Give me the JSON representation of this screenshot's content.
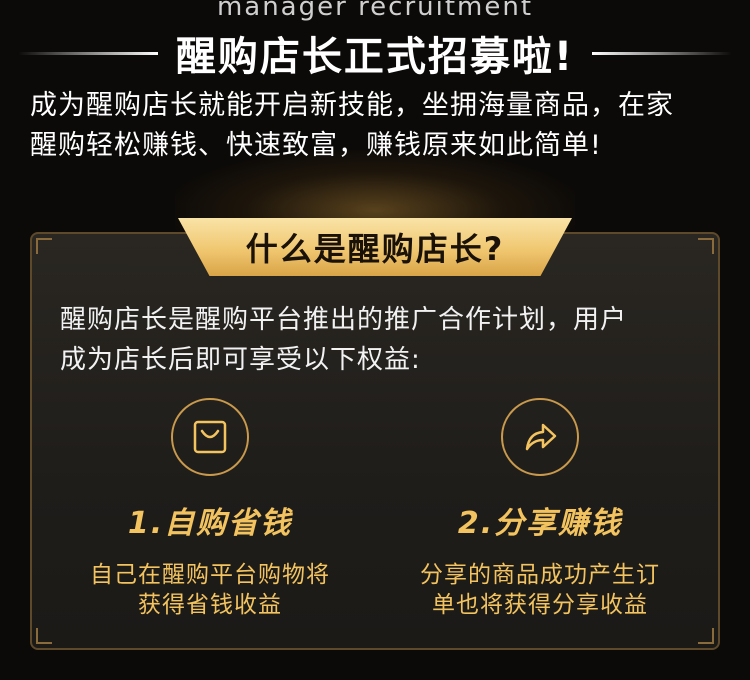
{
  "header": {
    "english_title": "manager recruitment",
    "main_title": "醒购店长正式招募啦!",
    "intro_lines": [
      "成为醒购店长就能开启新技能，坐拥海量商品，在家",
      "醒购轻松赚钱、快速致富，赚钱原来如此简单!"
    ]
  },
  "card": {
    "banner_title": "什么是醒购店长?",
    "description_lines": [
      "醒购店长是醒购平台推出的推广合作计划，用户",
      "成为店长后即可享受以下权益:"
    ],
    "benefits": [
      {
        "icon": "shopping-bag-icon",
        "title": "1.自购省钱",
        "desc_lines": [
          "自己在醒购平台购物将",
          "获得省钱收益"
        ]
      },
      {
        "icon": "share-arrow-icon",
        "title": "2.分享赚钱",
        "desc_lines": [
          "分享的商品成功产生订",
          "单也将获得分享收益"
        ]
      }
    ]
  },
  "colors": {
    "accent_gold": "#f2c35f",
    "banner_gold": "#f0c770",
    "card_border": "#5e4a2b",
    "background": "#0c0a08"
  }
}
